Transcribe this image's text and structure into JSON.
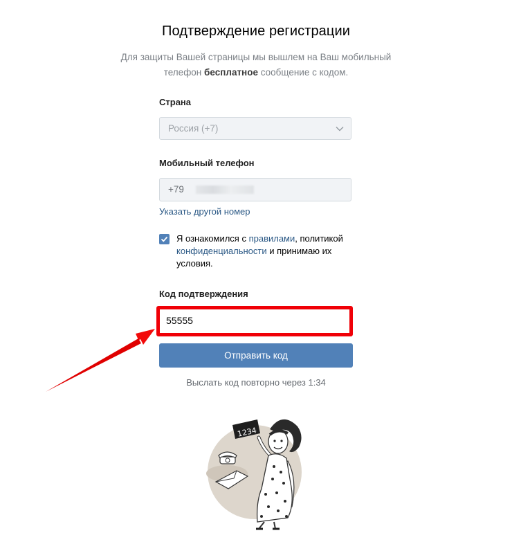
{
  "header": {
    "title": "Подтверждение регистрации",
    "subtitle_pre": "Для защиты Вашей страницы мы вышлем на Ваш мобильный телефон ",
    "subtitle_bold": "бесплатное",
    "subtitle_post": " сообщение с кодом."
  },
  "country": {
    "label": "Страна",
    "value": "Россия (+7)"
  },
  "phone": {
    "label": "Мобильный телефон",
    "value": "+79",
    "change_link": "Указать другой номер"
  },
  "terms": {
    "checked": true,
    "text_1": "Я ознакомился с ",
    "rules_link": "правилами",
    "text_2": ", политикой ",
    "privacy_link": "конфиденциальности",
    "text_3": " и принимаю их условия."
  },
  "code": {
    "label": "Код подтверждения",
    "value": "55555"
  },
  "submit": {
    "label": "Отправить код"
  },
  "resend": {
    "text": "Выслать код повторно через 1:34"
  },
  "illustration": {
    "card_text": "1234"
  },
  "colors": {
    "accent": "#5181b8",
    "link": "#2a5885",
    "highlight": "#f00007"
  }
}
